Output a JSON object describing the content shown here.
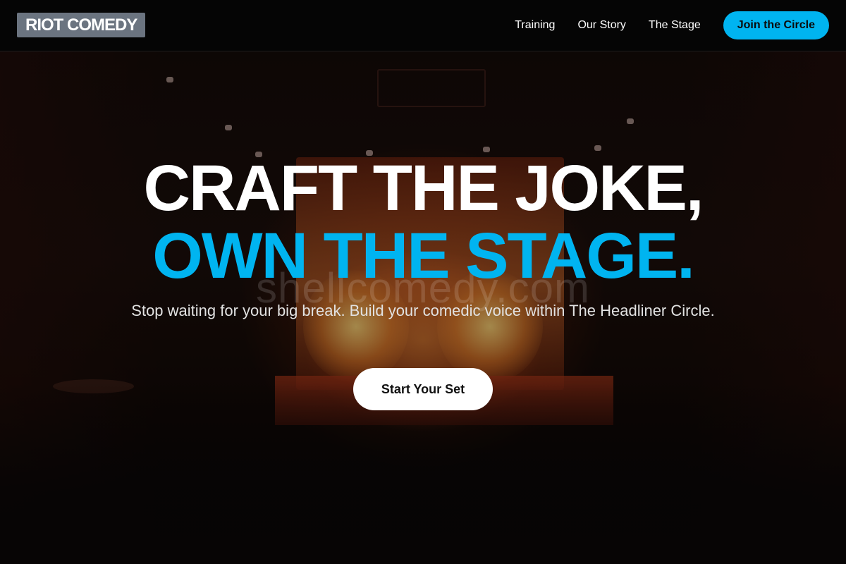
{
  "brand": {
    "logo_text": "RIOT COMEDY"
  },
  "nav": {
    "links": [
      {
        "label": "Training"
      },
      {
        "label": "Our Story"
      },
      {
        "label": "The Stage"
      }
    ],
    "cta_label": "Join the Circle"
  },
  "hero": {
    "headline_line1": "CRAFT THE JOKE,",
    "headline_line2": "OWN THE STAGE.",
    "subtitle": "Stop waiting for your big break. Build your comedic voice within The Headliner Circle.",
    "cta_label": "Start Your Set",
    "watermark": "shellcomedy.com"
  },
  "colors": {
    "accent": "#00b4f0",
    "header_background": "#050505",
    "logo_background": "#6b7480",
    "hero_button_background": "#ffffff"
  }
}
